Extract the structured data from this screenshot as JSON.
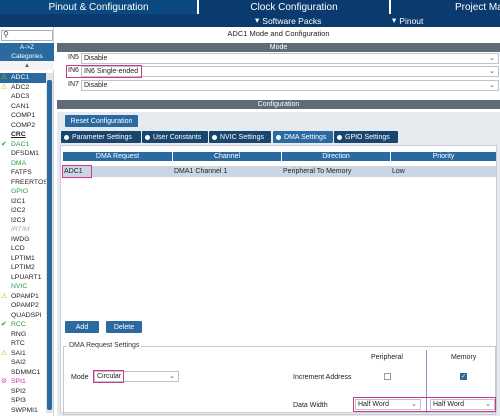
{
  "top_tabs": [
    {
      "label": "Pinout & Configuration"
    },
    {
      "label": "Clock Configuration"
    },
    {
      "label": "Project Ma"
    }
  ],
  "sub_menu": [
    {
      "label": "Software Packs"
    },
    {
      "label": "Pinout"
    }
  ],
  "left": {
    "sort_label": "A->Z",
    "categories_label": "Categories",
    "items": [
      {
        "label": "ADC1",
        "mark": "warn",
        "selected": true,
        "color": "#ffffff"
      },
      {
        "label": "ADC2",
        "mark": "warn",
        "color": "#222222"
      },
      {
        "label": "ADC3",
        "mark": "",
        "color": "#222222"
      },
      {
        "label": "CAN1",
        "mark": "",
        "color": "#222222"
      },
      {
        "label": "COMP1",
        "mark": "",
        "color": "#222222"
      },
      {
        "label": "COMP2",
        "mark": "",
        "color": "#222222"
      },
      {
        "label": "CRC",
        "mark": "",
        "color": "#222222",
        "bold": true
      },
      {
        "label": "DAC1",
        "mark": "check",
        "color": "#2e9e3e"
      },
      {
        "label": "DFSDM1",
        "mark": "",
        "color": "#222222"
      },
      {
        "label": "DMA",
        "mark": "",
        "color": "#2e9e3e"
      },
      {
        "label": "FATFS",
        "mark": "",
        "color": "#222222"
      },
      {
        "label": "FREERTOS",
        "mark": "",
        "color": "#222222"
      },
      {
        "label": "GPIO",
        "mark": "",
        "color": "#2e9e3e"
      },
      {
        "label": "I2C1",
        "mark": "",
        "color": "#222222"
      },
      {
        "label": "I2C2",
        "mark": "",
        "color": "#222222"
      },
      {
        "label": "I2C3",
        "mark": "",
        "color": "#222222"
      },
      {
        "label": "IRTIM",
        "mark": "",
        "color": "#a8a8a8",
        "italic": true
      },
      {
        "label": "IWDG",
        "mark": "",
        "color": "#222222"
      },
      {
        "label": "LCD",
        "mark": "",
        "color": "#222222"
      },
      {
        "label": "LPTIM1",
        "mark": "",
        "color": "#222222"
      },
      {
        "label": "LPTIM2",
        "mark": "",
        "color": "#222222"
      },
      {
        "label": "LPUART1",
        "mark": "",
        "color": "#222222"
      },
      {
        "label": "NVIC",
        "mark": "",
        "color": "#2e9e3e"
      },
      {
        "label": "OPAMP1",
        "mark": "warn",
        "color": "#222222"
      },
      {
        "label": "OPAMP2",
        "mark": "",
        "color": "#222222"
      },
      {
        "label": "QUADSPI",
        "mark": "",
        "color": "#222222"
      },
      {
        "label": "RCC",
        "mark": "check",
        "color": "#2e9e3e"
      },
      {
        "label": "RNG",
        "mark": "",
        "color": "#222222"
      },
      {
        "label": "RTC",
        "mark": "",
        "color": "#222222"
      },
      {
        "label": "SAI1",
        "mark": "warn",
        "color": "#222222"
      },
      {
        "label": "SAI2",
        "mark": "",
        "color": "#222222"
      },
      {
        "label": "SDMMC1",
        "mark": "",
        "color": "#222222"
      },
      {
        "label": "SPI1",
        "mark": "blocked",
        "color": "#c0339a"
      },
      {
        "label": "SPI2",
        "mark": "",
        "color": "#222222"
      },
      {
        "label": "SPI3",
        "mark": "",
        "color": "#222222"
      },
      {
        "label": "SWPMI1",
        "mark": "",
        "color": "#222222"
      }
    ]
  },
  "main": {
    "title": "ADC1 Mode and Configuration",
    "mode_header": "Mode",
    "modes": [
      {
        "label": "IN5",
        "value": "Disable"
      },
      {
        "label": "IN6",
        "value": "IN6 Single-ended"
      },
      {
        "label": "IN7",
        "value": "Disable"
      }
    ],
    "config_header": "Configuration",
    "reset_label": "Reset Configuration",
    "config_tabs": [
      {
        "label": "Parameter Settings"
      },
      {
        "label": "User Constants"
      },
      {
        "label": "NVIC Settings"
      },
      {
        "label": "DMA Settings"
      },
      {
        "label": "GPIO Settings"
      }
    ],
    "dma_table": {
      "headers": [
        "DMA Request",
        "Channel",
        "Direction",
        "Priority"
      ],
      "rows": [
        [
          "ADC1",
          "DMA1 Channel 1",
          "Peripheral To Memory",
          "Low"
        ]
      ]
    },
    "add_label": "Add",
    "delete_label": "Delete",
    "dma_request_settings": {
      "group_label": "DMA Request Settings",
      "peripheral_label": "Peripheral",
      "memory_label": "Memory",
      "mode_label": "Mode",
      "mode_value": "Circular",
      "increment_label": "Increment Address",
      "peripheral_increment": false,
      "memory_increment": true,
      "data_width_label": "Data Width",
      "peripheral_width": "Half Word",
      "memory_width": "Half Word"
    }
  }
}
